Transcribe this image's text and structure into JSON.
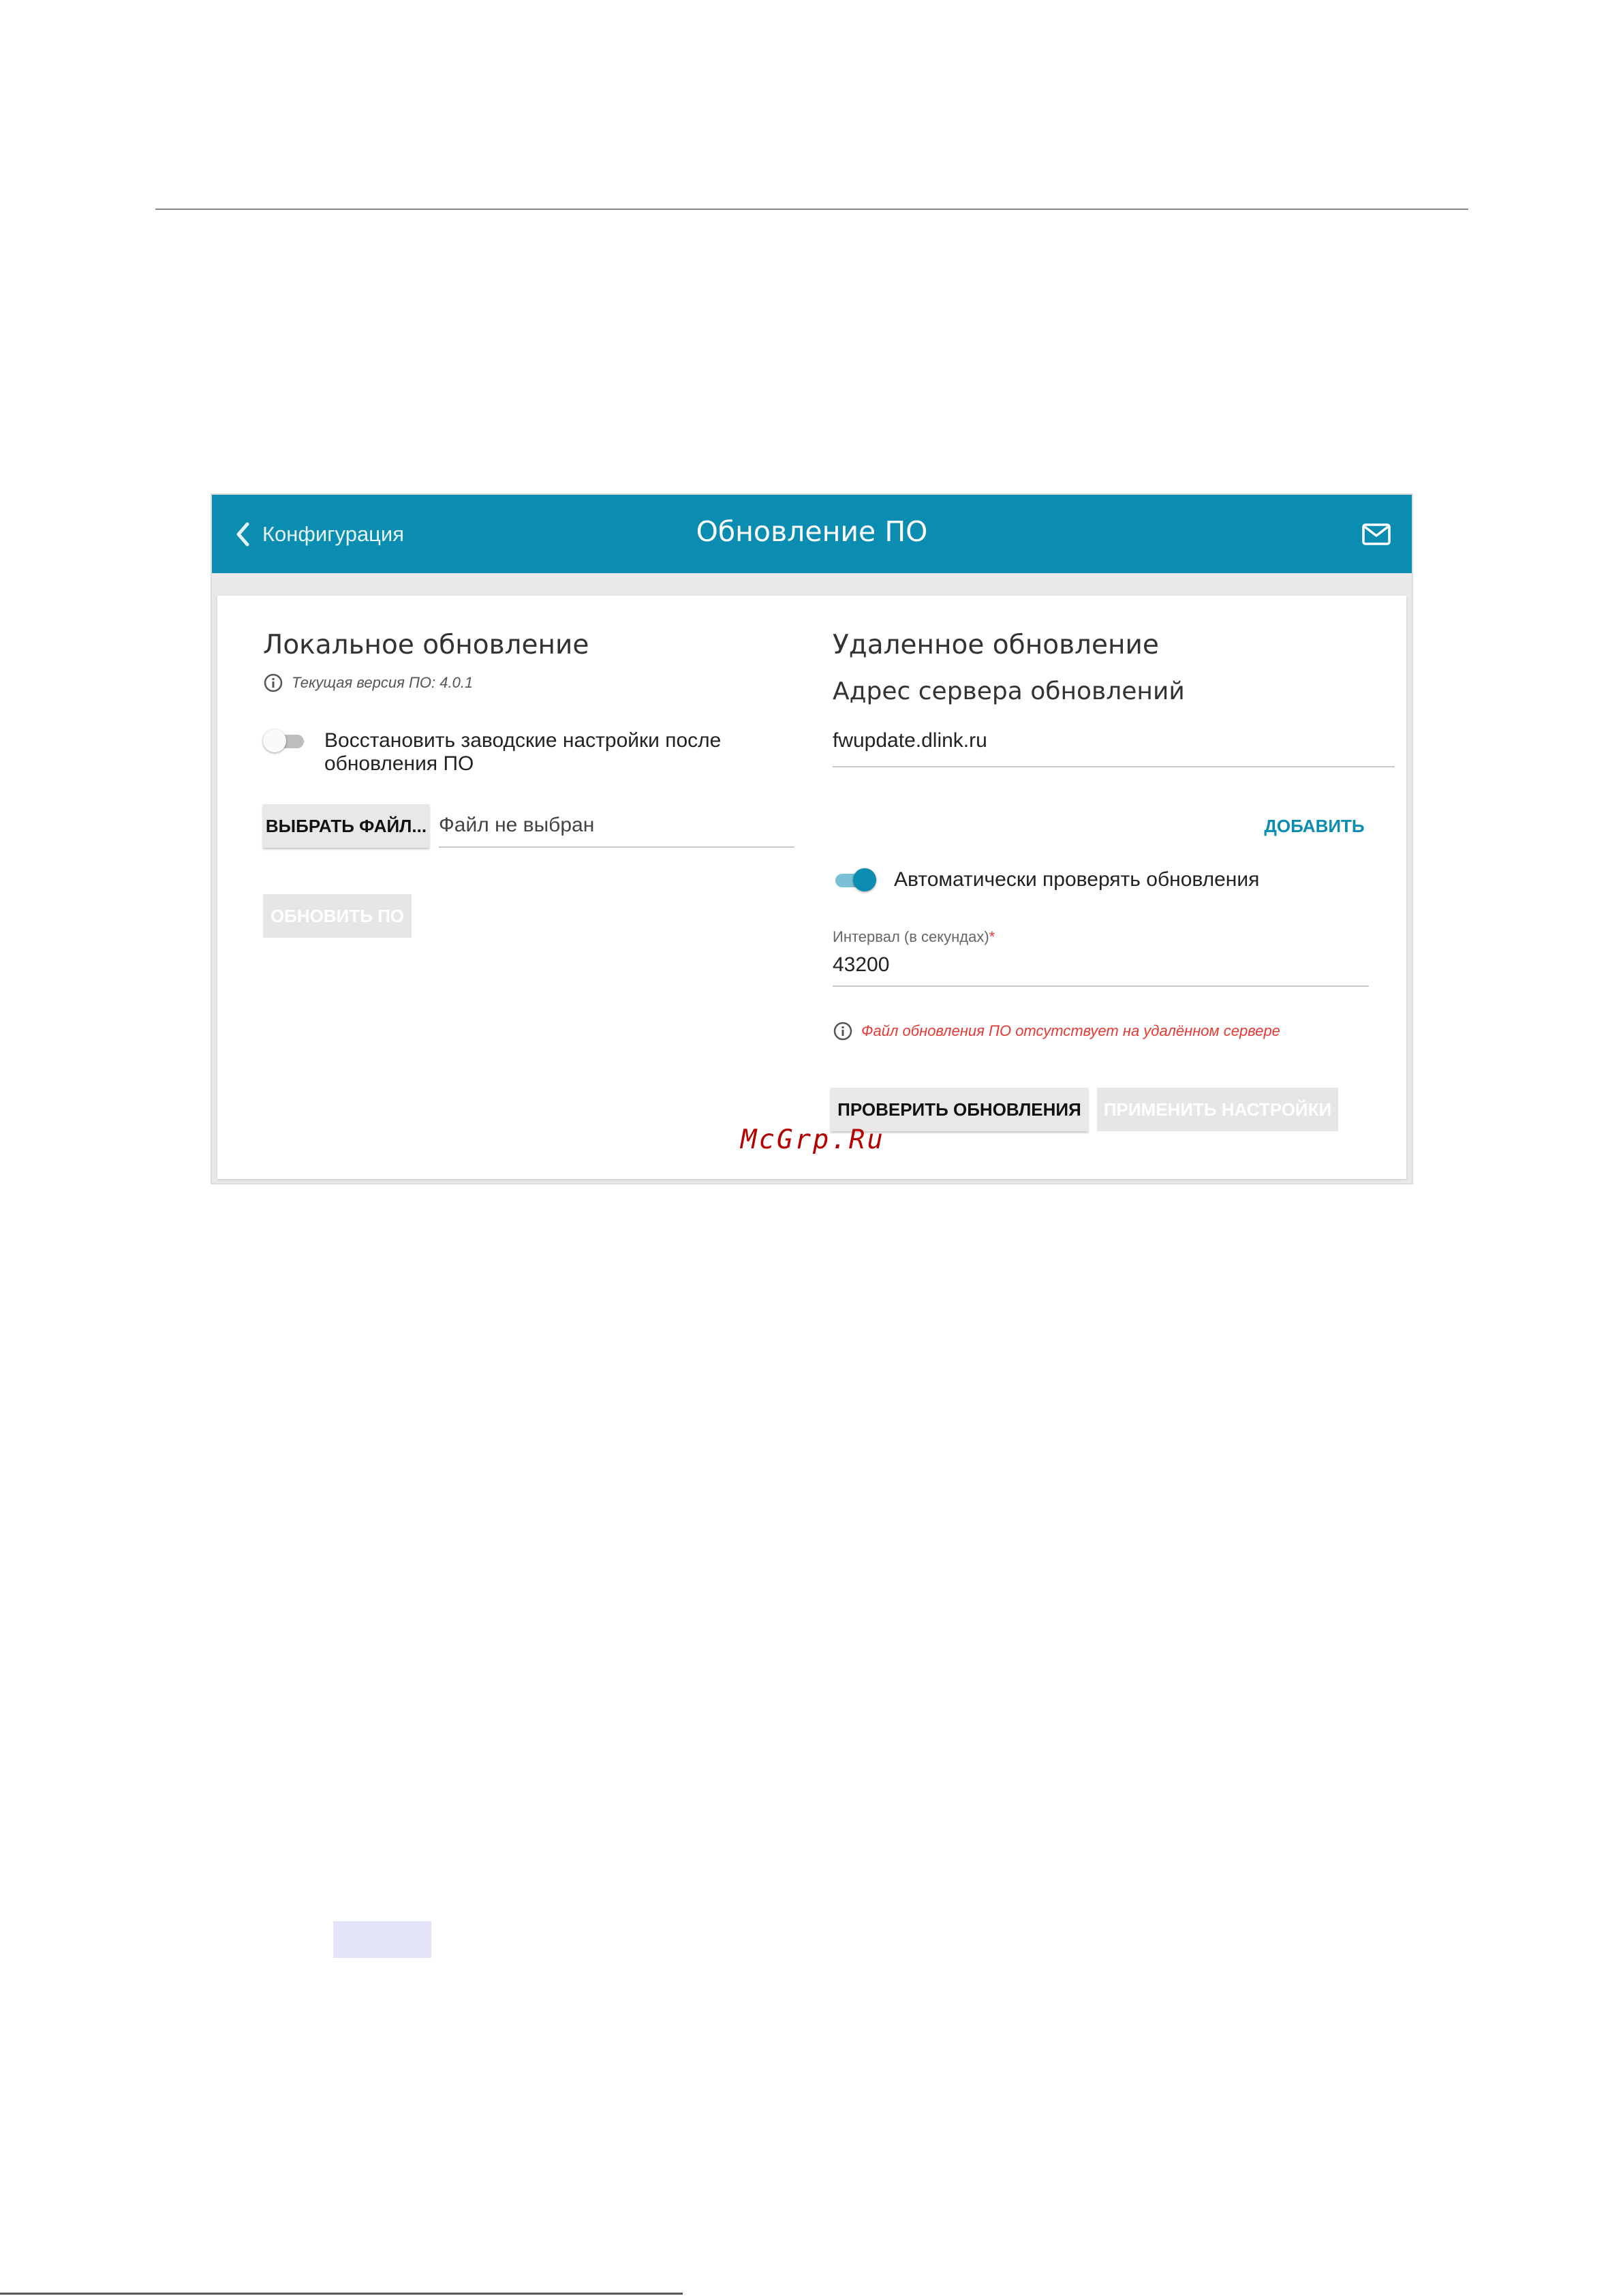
{
  "appbar": {
    "back_label": "Конфигурация",
    "title": "Обновление ПО",
    "color": "#0a8db0"
  },
  "local": {
    "heading": "Локальное обновление",
    "version_note": "Текущая версия ПО: 4.0.1",
    "restore_toggle_label_line1": "Восстановить заводские настройки после",
    "restore_toggle_label_line2": "обновления ПО",
    "restore_toggle_on": false,
    "choose_file_button": "ВЫБРАТЬ ФАЙЛ...",
    "file_placeholder": "Файл не выбран",
    "update_button": "ОБНОВИТЬ ПО"
  },
  "remote": {
    "heading": "Удаленное обновление",
    "server_heading": "Адрес сервера обновлений",
    "server_value": "fwupdate.dlink.ru",
    "add_button": "ДОБАВИТЬ",
    "auto_check_label": "Автоматически проверять обновления",
    "auto_check_on": true,
    "interval_label": "Интервал (в секундах)",
    "interval_required_mark": "*",
    "interval_value": "43200",
    "error_note": "Файл обновления ПО отсутствует на удалённом сервере",
    "check_button": "ПРОВЕРИТЬ ОБНОВЛЕНИЯ",
    "apply_button": "ПРИМЕНИТЬ НАСТРОЙКИ",
    "error_color": "#e53935"
  },
  "watermark": "McGrp.Ru",
  "icons": {
    "back": "chevron-left-icon",
    "mail": "mail-icon",
    "info": "info-icon"
  }
}
